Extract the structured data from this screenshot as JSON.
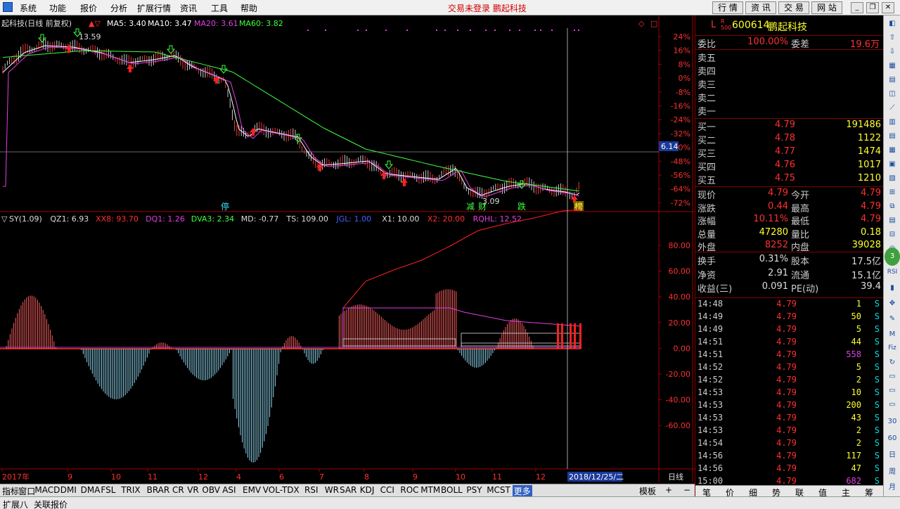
{
  "menu": {
    "items": [
      "系统",
      "功能",
      "报价",
      "分析",
      "扩展行情",
      "资讯",
      "工具",
      "帮助"
    ],
    "notice": "交易未登录 鹏起科技",
    "tabs": [
      "行 情",
      "资 讯",
      "交 易",
      "网 站"
    ]
  },
  "main_chart": {
    "title": "起科技(日线 前复权)",
    "ma_labels": [
      {
        "text": "MA5: 3.40",
        "color": "#ffffff"
      },
      {
        "text": "MA10: 3.47",
        "color": "#ffffff"
      },
      {
        "text": "MA20: 3.61",
        "color": "#e040e0"
      },
      {
        "text": "MA60: 3.82",
        "color": "#40ff40"
      }
    ],
    "high_label": "13.59",
    "low_label": "3.09",
    "pct_ticks": [
      "24%",
      "16%",
      "8%",
      "0%",
      "-8%",
      "-16%",
      "-24%",
      "-32%",
      "-40%",
      "-48%",
      "-56%",
      "-64%",
      "-72%"
    ],
    "cursor_price": "6.14",
    "events": [
      {
        "text": "停",
        "color": "#40e0ff"
      },
      {
        "text": "减",
        "color": "#40ff40"
      },
      {
        "text": "财",
        "color": "#40ff40"
      },
      {
        "text": "跌",
        "color": "#40ff40"
      },
      {
        "text": "榜",
        "color": "#ffff40"
      }
    ]
  },
  "indicator": {
    "labels": [
      {
        "text": "SY(1.09)",
        "color": "#dddddd"
      },
      {
        "text": "QZ1: 6.93",
        "color": "#dddddd"
      },
      {
        "text": "XX8: 93.70",
        "color": "#ff3030"
      },
      {
        "text": "DQ1: 1.26",
        "color": "#e040e0"
      },
      {
        "text": "DVA3: 2.34",
        "color": "#40ff40"
      },
      {
        "text": "MD: -0.77",
        "color": "#dddddd"
      },
      {
        "text": "TS: 109.00",
        "color": "#dddddd"
      },
      {
        "text": "JGL: 1.00",
        "color": "#4060ff"
      },
      {
        "text": "X1: 10.00",
        "color": "#dddddd"
      },
      {
        "text": "X2: 20.00",
        "color": "#ff3030"
      },
      {
        "text": "RQHL: 12.52",
        "color": "#e040e0"
      }
    ],
    "ticks": [
      "80.00",
      "60.00",
      "40.00",
      "20.00",
      "0.00",
      "-20.00",
      "-40.00",
      "-60.00"
    ]
  },
  "time_axis": {
    "labels": [
      "2017年",
      "9",
      "10",
      "11",
      "12",
      "4",
      "6",
      "7",
      "8",
      "9",
      "10",
      "11",
      "12"
    ],
    "cursor_date": "2018/12/25/二",
    "period": "日线"
  },
  "indicator_tabs": [
    "指标",
    "窗口",
    "MACD",
    "DMI",
    "DMA",
    "FSL",
    "TRIX",
    "BRAR",
    "CR",
    "VR",
    "OBV",
    "ASI",
    "EMV",
    "VOL-TDX",
    "RSI",
    "WR",
    "SAR",
    "KDJ",
    "CCI",
    "ROC",
    "MTM",
    "BOLL",
    "PSY",
    "MCST",
    "更多"
  ],
  "template_btn": "模板",
  "quote": {
    "code": "600614",
    "name": "鹏起科技",
    "ratio_label": "委比",
    "ratio_value": "100.00%",
    "diff_label": "委差",
    "diff_value": "19.6万",
    "asks": [
      "卖五",
      "卖四",
      "卖三",
      "卖二",
      "卖一"
    ],
    "bids": [
      {
        "label": "买一",
        "price": "4.79",
        "vol": "191486"
      },
      {
        "label": "买二",
        "price": "4.78",
        "vol": "1122"
      },
      {
        "label": "买三",
        "price": "4.77",
        "vol": "1474"
      },
      {
        "label": "买四",
        "price": "4.76",
        "vol": "1017"
      },
      {
        "label": "买五",
        "price": "4.75",
        "vol": "1210"
      }
    ],
    "stats": [
      {
        "l": "现价",
        "v": "4.79",
        "vc": "red",
        "l2": "今开",
        "v2": "4.79",
        "v2c": "red"
      },
      {
        "l": "涨跌",
        "v": "0.44",
        "vc": "red",
        "l2": "最高",
        "v2": "4.79",
        "v2c": "red"
      },
      {
        "l": "涨幅",
        "v": "10.11%",
        "vc": "red",
        "l2": "最低",
        "v2": "4.79",
        "v2c": "red"
      },
      {
        "l": "总量",
        "v": "47280",
        "vc": "yel",
        "l2": "量比",
        "v2": "0.18",
        "v2c": "yel"
      },
      {
        "l": "外盘",
        "v": "8252",
        "vc": "red",
        "l2": "内盘",
        "v2": "39028",
        "v2c": "yel"
      }
    ],
    "stats2": [
      {
        "l": "换手",
        "v": "0.31%",
        "l2": "股本",
        "v2": "17.5亿"
      },
      {
        "l": "净资",
        "v": "2.91",
        "l2": "流通",
        "v2": "15.1亿"
      },
      {
        "l": "收益(三)",
        "v": "0.091",
        "l2": "PE(动)",
        "v2": "39.4"
      }
    ],
    "ticks": [
      {
        "t": "14:48",
        "p": "4.79",
        "v": "1",
        "vc": "yel"
      },
      {
        "t": "14:49",
        "p": "4.79",
        "v": "50",
        "vc": "yel"
      },
      {
        "t": "14:49",
        "p": "4.79",
        "v": "5",
        "vc": "yel"
      },
      {
        "t": "14:51",
        "p": "4.79",
        "v": "44",
        "vc": "yel"
      },
      {
        "t": "14:51",
        "p": "4.79",
        "v": "558",
        "vc": "mag"
      },
      {
        "t": "14:52",
        "p": "4.79",
        "v": "5",
        "vc": "yel"
      },
      {
        "t": "14:52",
        "p": "4.79",
        "v": "2",
        "vc": "yel"
      },
      {
        "t": "14:53",
        "p": "4.79",
        "v": "10",
        "vc": "yel"
      },
      {
        "t": "14:53",
        "p": "4.79",
        "v": "200",
        "vc": "yel"
      },
      {
        "t": "14:53",
        "p": "4.79",
        "v": "43",
        "vc": "yel"
      },
      {
        "t": "14:53",
        "p": "4.79",
        "v": "2",
        "vc": "yel"
      },
      {
        "t": "14:54",
        "p": "4.79",
        "v": "2",
        "vc": "yel"
      },
      {
        "t": "14:56",
        "p": "4.79",
        "v": "117",
        "vc": "yel"
      },
      {
        "t": "14:56",
        "p": "4.79",
        "v": "47",
        "vc": "yel"
      },
      {
        "t": "15:00",
        "p": "4.79",
        "v": "682",
        "vc": "mag"
      }
    ],
    "tick_flag": "S",
    "bottom_tabs": [
      "笔",
      "价",
      "细",
      "势",
      "联",
      "值",
      "主",
      "筹"
    ]
  },
  "tools": [
    "3",
    "RSI",
    "M",
    "Fiz",
    "30",
    "60",
    "日",
    "周",
    "月"
  ],
  "status": {
    "left": "扩展八",
    "right": "关联报价"
  }
}
